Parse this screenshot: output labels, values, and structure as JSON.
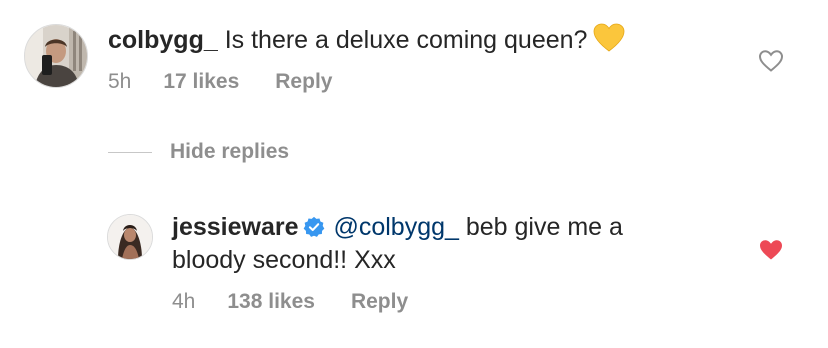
{
  "comments": [
    {
      "username": "colbygg_",
      "text": "Is there a deluxe coming queen?",
      "emoji": "yellow-heart-emoji",
      "time": "5h",
      "likes": "17 likes",
      "reply_label": "Reply",
      "liked": false
    }
  ],
  "hide_replies_label": "Hide replies",
  "replies": [
    {
      "username": "jessieware",
      "verified": true,
      "mention": "@colbygg_",
      "text": "beb give me a bloody second!! Xxx",
      "time": "4h",
      "likes": "138 likes",
      "reply_label": "Reply",
      "liked": true
    }
  ],
  "colors": {
    "text": "#262626",
    "secondary": "#8e8e8e",
    "mention": "#00376b",
    "verified": "#3897f0",
    "liked_heart": "#ed4956"
  }
}
